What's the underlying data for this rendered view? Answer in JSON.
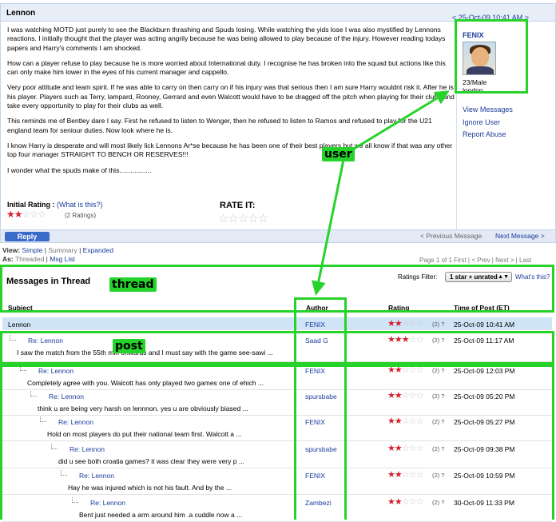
{
  "message": {
    "title": "Lennon",
    "date": "< 25-Oct-09 10:41 AM >",
    "paragraphs": [
      "I was watching MOTD just purely to see the Blackburn thrashing and Spuds losing. While watching the yids lose I was also mystified by Lennons reactions. I initially thought that the player was acting angrily because he was being allowed to play because of the injury. However reading todays papers and Harry's comments I am shocked.",
      "How can a player refuse to play because he is more worried about International duty. I recognise he has broken into the squad but actions like this can only make him lower in the eyes of his current manager and cappello.",
      "Very poor attitude and team spirit. If he was able to carry on then carry on if his injury was that serious then I am sure Harry wouldnt risk it. After he is his player. Players such as Terry, lampard, Rooney, Gerrard and even Walcott would have to be dragged off the pitch when playing for their clubs and take every opportunity to play for their clubs as well.",
      "This reminds me of Bentley dare I say. First he refused to listen to Wenger, then he refused to listen to Ramos and refused to play for the U21 england team for seniour duties. Now look where he is.",
      "I know Harry is desperate and will most likely lick Lennons Ar*se because he has been one of their best players but we all know if that was any other top four manager STRAIGHT TO BENCH OR RESERVES!!!",
      "I wonder what the spuds make of this................."
    ],
    "initial_rating_label": "Initial Rating :",
    "whats_this": "(What is this?)",
    "ratings_count": "(2 Ratings)",
    "initial_stars": 2,
    "rate_it_label": "RATE IT:",
    "reply_label": "Reply",
    "prev_label": "< Previous Message",
    "next_label": "Next Message >"
  },
  "user": {
    "name": "FENIX",
    "age_gender": "23/Male",
    "location": "london",
    "view_messages": "View Messages",
    "ignore_user": "Ignore User",
    "report_abuse": "Report Abuse"
  },
  "view": {
    "view_label": "View:",
    "simple": "Simple",
    "summary": "Summary",
    "expanded": "Expanded",
    "as_label": "As:",
    "threaded": "Threaded",
    "msg_list": "Msg List",
    "pager": "Page 1 of 1   First | < Prev | Next > | Last"
  },
  "thread": {
    "title": "Messages in Thread",
    "filter_label": "Ratings Filter:",
    "filter_value": "1 star + unrated",
    "whats_this": "What's this?",
    "headers": {
      "subject": "Subject",
      "author": "Author",
      "rating": "Rating",
      "time": "Time of Post (ET)"
    },
    "rows": [
      {
        "subject": "Lennon",
        "excerpt": "",
        "author": "FENIX",
        "stars": 2,
        "count": "(2) ?",
        "time": "25-Oct-09 10:41 AM"
      },
      {
        "subject": "Re: Lennon",
        "excerpt": "I saw the match from the 55th min onwards and I must say with the game see-sawi ...",
        "author": "Saad G",
        "stars": 3,
        "count": "(2) ?",
        "time": "25-Oct-09 11:17 AM"
      },
      {
        "subject": "Re: Lennon",
        "excerpt": "Completely agree with you. Walcott has only played two games one of ehich ...",
        "author": "FENIX",
        "stars": 2,
        "count": "(2) ?",
        "time": "25-Oct-09 12:03 PM"
      },
      {
        "subject": "Re: Lennon",
        "excerpt": "think u are being very harsh on lennnon. yes u are obviously biased ...",
        "author": "spursbabe",
        "stars": 2,
        "count": "(2) ?",
        "time": "25-Oct-09 05:20 PM"
      },
      {
        "subject": "Re: Lennon",
        "excerpt": "Hold on most players do put their national team first. Walcott a ...",
        "author": "FENIX",
        "stars": 2,
        "count": "(2) ?",
        "time": "25-Oct-09 05:27 PM"
      },
      {
        "subject": "Re: Lennon",
        "excerpt": "did u see both croatia games? it was clear they were very p ...",
        "author": "spursbabe",
        "stars": 2,
        "count": "(2) ?",
        "time": "25-Oct-09 09:38 PM"
      },
      {
        "subject": "Re: Lennon",
        "excerpt": "Hay he was injured which is not his fault. And by the ...",
        "author": "FENIX",
        "stars": 2,
        "count": "(2) ?",
        "time": "25-Oct-09 10:59 PM"
      },
      {
        "subject": "Re: Lennon",
        "excerpt": "Bent just needed a arm around him .a cuddle now a ...",
        "author": "Zambezi",
        "stars": 2,
        "count": "(2) ?",
        "time": "30-Oct-09 11:33 PM"
      }
    ]
  },
  "annotations": {
    "user": "user",
    "thread": "thread",
    "post": "post"
  },
  "colors": {
    "annotation": "#25d32a",
    "link": "#1a3c9b",
    "star": "#d4202c",
    "selected_row": "#cfe4f7"
  }
}
